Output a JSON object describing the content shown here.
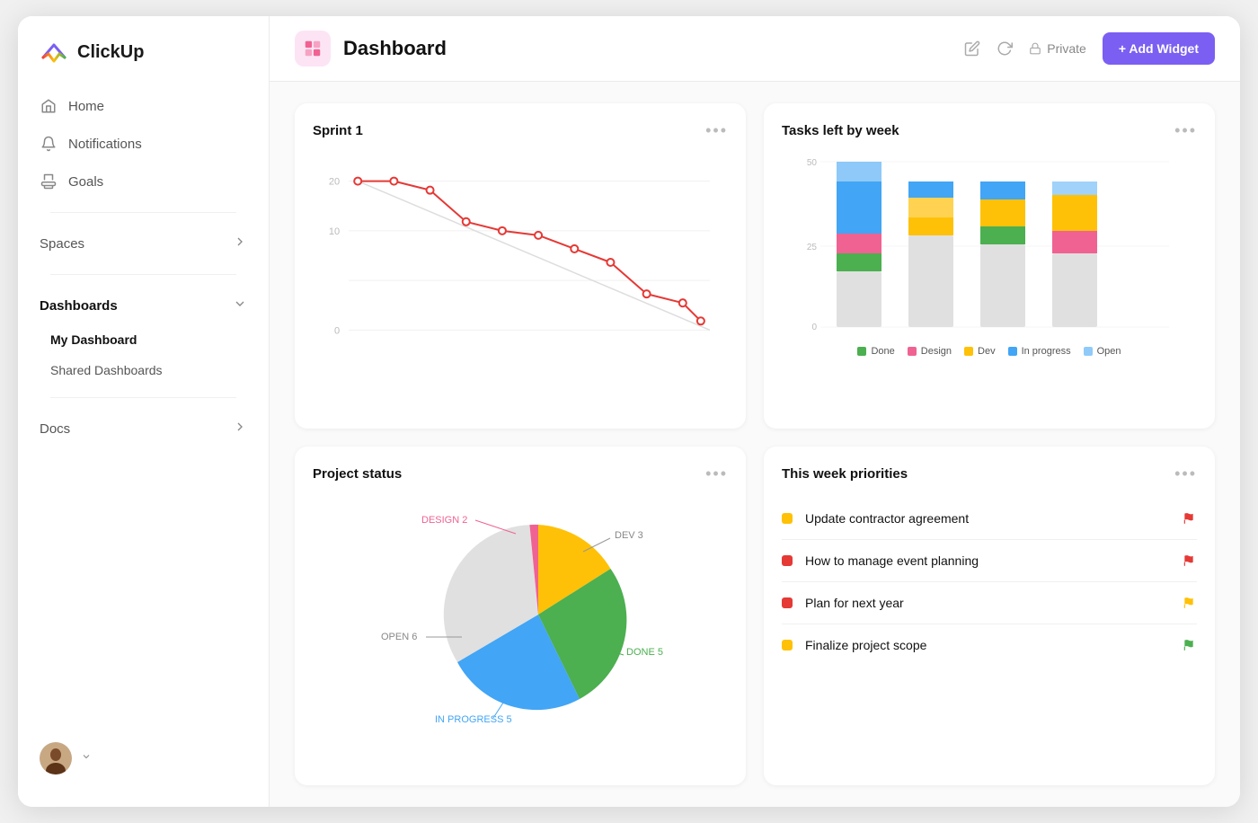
{
  "app": {
    "name": "ClickUp"
  },
  "sidebar": {
    "nav": [
      {
        "id": "home",
        "label": "Home",
        "icon": "home-icon"
      },
      {
        "id": "notifications",
        "label": "Notifications",
        "icon": "bell-icon"
      },
      {
        "id": "goals",
        "label": "Goals",
        "icon": "trophy-icon"
      }
    ],
    "sections": [
      {
        "id": "spaces",
        "label": "Spaces",
        "expanded": false
      },
      {
        "id": "dashboards",
        "label": "Dashboards",
        "expanded": true
      }
    ],
    "dashboardItems": [
      {
        "id": "my-dashboard",
        "label": "My Dashboard",
        "active": true
      },
      {
        "id": "shared-dashboards",
        "label": "Shared Dashboards",
        "active": false
      }
    ],
    "docsSection": {
      "label": "Docs",
      "expanded": false
    }
  },
  "topbar": {
    "title": "Dashboard",
    "privateLabel": "Private",
    "addWidgetLabel": "+ Add Widget"
  },
  "sprint": {
    "title": "Sprint 1",
    "yMax": 20,
    "yMid": 10,
    "yMin": 0
  },
  "tasksChart": {
    "title": "Tasks left by week",
    "yMax": 50,
    "yMid": 25,
    "yMin": 0,
    "legend": [
      {
        "label": "Done",
        "color": "#4caf50"
      },
      {
        "label": "Design",
        "color": "#f06292"
      },
      {
        "label": "Dev",
        "color": "#ffc107"
      },
      {
        "label": "In progress",
        "color": "#42a5f5"
      },
      {
        "label": "Open",
        "color": "#90caf9"
      }
    ]
  },
  "projectStatus": {
    "title": "Project status",
    "segments": [
      {
        "label": "DEV 3",
        "value": 3,
        "color": "#ffc107"
      },
      {
        "label": "DONE 5",
        "value": 5,
        "color": "#4caf50"
      },
      {
        "label": "IN PROGRESS 5",
        "value": 5,
        "color": "#42a5f5"
      },
      {
        "label": "OPEN 6",
        "value": 6,
        "color": "#e0e0e0"
      },
      {
        "label": "DESIGN 2",
        "value": 2,
        "color": "#f06292"
      }
    ]
  },
  "priorities": {
    "title": "This week priorities",
    "items": [
      {
        "text": "Update contractor agreement",
        "dotColor": "#ffc107",
        "flagColor": "#e53935"
      },
      {
        "text": "How to manage event planning",
        "dotColor": "#e53935",
        "flagColor": "#e53935"
      },
      {
        "text": "Plan for next year",
        "dotColor": "#e53935",
        "flagColor": "#ffc107"
      },
      {
        "text": "Finalize project scope",
        "dotColor": "#ffc107",
        "flagColor": "#4caf50"
      }
    ]
  }
}
